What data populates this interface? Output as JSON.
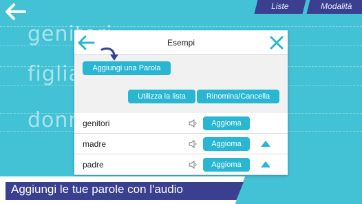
{
  "colors": {
    "background": "#43c1d5",
    "accent": "#29b6d3",
    "tab_bg": "#3a3f8f",
    "banner_bg": "#3a3f8f"
  },
  "top_tabs": [
    {
      "label": "Liste"
    },
    {
      "label": "Modalità"
    }
  ],
  "background_words": [
    "genitori",
    "figlia",
    "donna"
  ],
  "dialog": {
    "title": "Esempi",
    "back_icon": "arrow-left-icon",
    "close_icon": "close-icon",
    "add_word_label": "Aggiungi una Parola",
    "use_list_label": "Utilizza la lista",
    "rename_delete_label": "Rinomina/Cancella",
    "words": [
      {
        "word": "genitori",
        "update_label": "Aggioma",
        "has_up_arrow": false
      },
      {
        "word": "madre",
        "update_label": "Aggioma",
        "has_up_arrow": true
      },
      {
        "word": "padre",
        "update_label": "Aggioma",
        "has_up_arrow": true
      }
    ]
  },
  "caption": "Aggiungi le tue parole con l'audio"
}
